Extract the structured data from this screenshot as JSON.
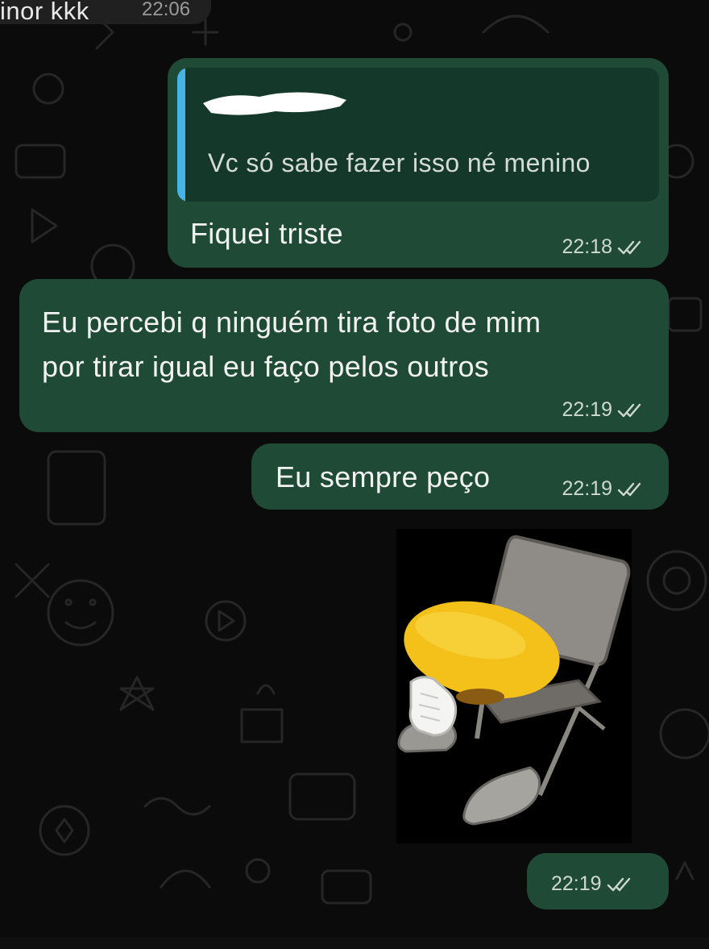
{
  "chat": {
    "previous_incoming": {
      "text": "inor kkk",
      "time": "22:06"
    },
    "messages": [
      {
        "reply_quote": {
          "sender_redacted": true,
          "text": "Vc só sabe fazer isso né menino"
        },
        "text": "Fiquei triste",
        "time": "22:18",
        "status": "read"
      },
      {
        "text_lines": [
          "Eu percebi q ninguém tira foto de mim",
          "por tirar igual eu faço pelos outros"
        ],
        "time": "22:19",
        "status": "read"
      },
      {
        "text": "Eu sempre peço",
        "time": "22:19",
        "status": "read"
      },
      {
        "type": "sticker",
        "sticker_description": "yellow emoji face sitting on grey folding chair",
        "time": "22:19",
        "status": "read"
      }
    ]
  },
  "colors": {
    "background": "#0b0b0b",
    "outgoing_bubble": "#1f4a35",
    "quote_background": "#14392a",
    "quote_accent": "#46b4e6",
    "incoming_bubble": "#202020",
    "text": "#f2f2f2"
  },
  "icons": [
    "double-check-icon",
    "wallpaper-doodles"
  ]
}
